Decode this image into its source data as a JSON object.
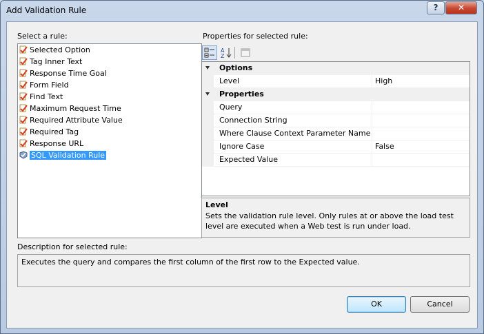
{
  "window": {
    "title": "Add Validation Rule"
  },
  "select_rule": {
    "label": "Select a rule:",
    "items": [
      {
        "label": "Selected Option"
      },
      {
        "label": "Tag Inner Text"
      },
      {
        "label": "Response Time Goal"
      },
      {
        "label": "Form Field"
      },
      {
        "label": "Find Text"
      },
      {
        "label": "Maximum Request Time"
      },
      {
        "label": "Required Attribute Value"
      },
      {
        "label": "Required Tag"
      },
      {
        "label": "Response URL"
      },
      {
        "label": "SQL Validation Rule"
      }
    ]
  },
  "properties": {
    "label": "Properties for selected rule:",
    "categories": [
      {
        "name": "Options",
        "rows": [
          {
            "name": "Level",
            "value": "High"
          }
        ]
      },
      {
        "name": "Properties",
        "rows": [
          {
            "name": "Query",
            "value": ""
          },
          {
            "name": "Connection String",
            "value": ""
          },
          {
            "name": "Where Clause Context Parameter Name",
            "value": ""
          },
          {
            "name": "Ignore Case",
            "value": "False"
          },
          {
            "name": "Expected Value",
            "value": ""
          }
        ]
      }
    ],
    "description": {
      "title": "Level",
      "text": "Sets the validation rule level.  Only rules at or above the load test level are executed when a Web test is run under load."
    }
  },
  "rule_description": {
    "label": "Description for selected rule:",
    "text": "Executes the query and compares the first column of the first row to the Expected value."
  },
  "buttons": {
    "ok": "OK",
    "cancel": "Cancel",
    "help": "?",
    "close": "✕"
  },
  "colors": {
    "selection": "#3399ff",
    "window_frame": "#b9cbe3"
  }
}
